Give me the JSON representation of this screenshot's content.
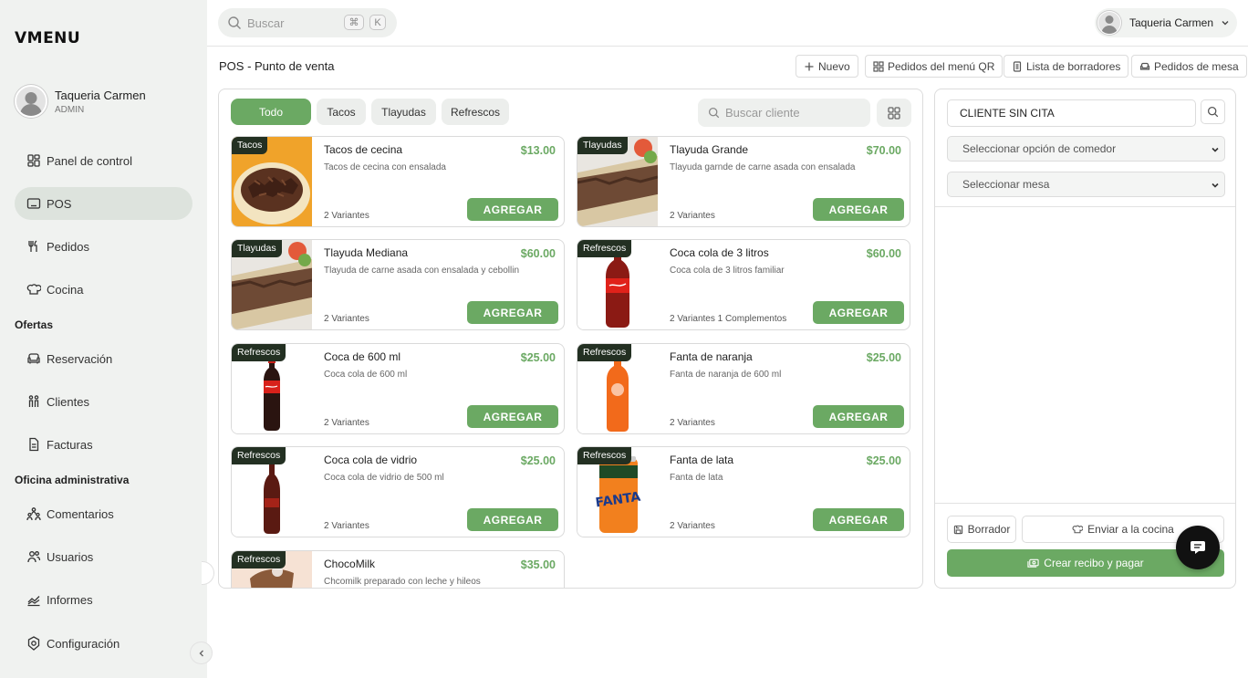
{
  "brand": "VMENU",
  "profile": {
    "name": "Taqueria Carmen",
    "role": "ADMIN"
  },
  "nav": {
    "items": [
      {
        "label": "Panel de control",
        "icon": "dashboard-icon",
        "active": false
      },
      {
        "label": "POS",
        "icon": "tablet-icon",
        "active": true
      },
      {
        "label": "Pedidos",
        "icon": "utensils-icon",
        "active": false
      },
      {
        "label": "Cocina",
        "icon": "chef-hat-icon",
        "active": false
      }
    ],
    "section_offers": "Ofertas",
    "offers": [
      {
        "label": "Reservación",
        "icon": "sofa-icon"
      },
      {
        "label": "Clientes",
        "icon": "people-icon"
      },
      {
        "label": "Facturas",
        "icon": "invoice-icon"
      }
    ],
    "section_admin": "Oficina administrativa",
    "admin": [
      {
        "label": "Comentarios",
        "icon": "comments-icon"
      },
      {
        "label": "Usuarios",
        "icon": "users-icon"
      },
      {
        "label": "Informes",
        "icon": "reports-icon"
      },
      {
        "label": "Configuración",
        "icon": "settings-icon"
      }
    ]
  },
  "topbar": {
    "search_placeholder": "Buscar",
    "shortcut_1": "⌘",
    "shortcut_2": "K",
    "user_name": "Taqueria Carmen"
  },
  "page": {
    "title": "POS - Punto de venta",
    "actions": [
      "Nuevo",
      "Pedidos del menú QR",
      "Lista de borradores",
      "Pedidos de mesa"
    ]
  },
  "filters": {
    "categories": [
      "Todo",
      "Tacos",
      "Tlayudas",
      "Refrescos"
    ],
    "active": "Todo",
    "client_search_placeholder": "Buscar cliente"
  },
  "products": [
    {
      "tag": "Tacos",
      "name": "Tacos de cecina",
      "price": "$13.00",
      "desc": "Tacos de cecina con ensalada",
      "variants": "2 Variantes",
      "button": "AGREGAR",
      "image": "tacos"
    },
    {
      "tag": "Tlayudas",
      "name": "Tlayuda Grande",
      "price": "$70.00",
      "desc": "Tlayuda garnde de carne asada con ensalada",
      "variants": "2 Variantes",
      "button": "AGREGAR",
      "image": "tlayuda"
    },
    {
      "tag": "Tlayudas",
      "name": "Tlayuda Mediana",
      "price": "$60.00",
      "desc": "Tlayuda de carne asada con ensalada y cebollin",
      "variants": "2 Variantes",
      "button": "AGREGAR",
      "image": "tlayuda"
    },
    {
      "tag": "Refrescos",
      "name": "Coca cola de 3 litros",
      "price": "$60.00",
      "desc": "Coca cola de 3 litros familiar",
      "variants": "2 Variantes 1 Complementos",
      "button": "AGREGAR",
      "image": "coke-big"
    },
    {
      "tag": "Refrescos",
      "name": "Coca de 600 ml",
      "price": "$25.00",
      "desc": "Coca cola de 600 ml",
      "variants": "2 Variantes",
      "button": "AGREGAR",
      "image": "coke-600"
    },
    {
      "tag": "Refrescos",
      "name": "Fanta de naranja",
      "price": "$25.00",
      "desc": "Fanta de naranja de 600 ml",
      "variants": "2 Variantes",
      "button": "AGREGAR",
      "image": "fanta-bottle"
    },
    {
      "tag": "Refrescos",
      "name": "Coca cola de vidrio",
      "price": "$25.00",
      "desc": "Coca cola de vidrio de 500 ml",
      "variants": "2 Variantes",
      "button": "AGREGAR",
      "image": "coke-glass"
    },
    {
      "tag": "Refrescos",
      "name": "Fanta de lata",
      "price": "$25.00",
      "desc": "Fanta de lata",
      "variants": "2 Variantes",
      "button": "AGREGAR",
      "image": "fanta-can"
    },
    {
      "tag": "Refrescos",
      "name": "ChocoMilk",
      "price": "$35.00",
      "desc": "Chcomilk preparado con leche y hileos",
      "variants": "",
      "button": "",
      "image": "chocomilk"
    }
  ],
  "order": {
    "client": "CLIENTE SIN CITA",
    "dining_option_placeholder": "Seleccionar opción de comedor",
    "table_placeholder": "Seleccionar mesa",
    "draft_button": "Borrador",
    "kitchen_button": "Enviar a la cocina",
    "pay_button": "Crear recibo y pagar"
  },
  "colors": {
    "accent": "#6ba963",
    "tag_bg": "#233022",
    "sidebar_bg": "#f0f2f0"
  }
}
